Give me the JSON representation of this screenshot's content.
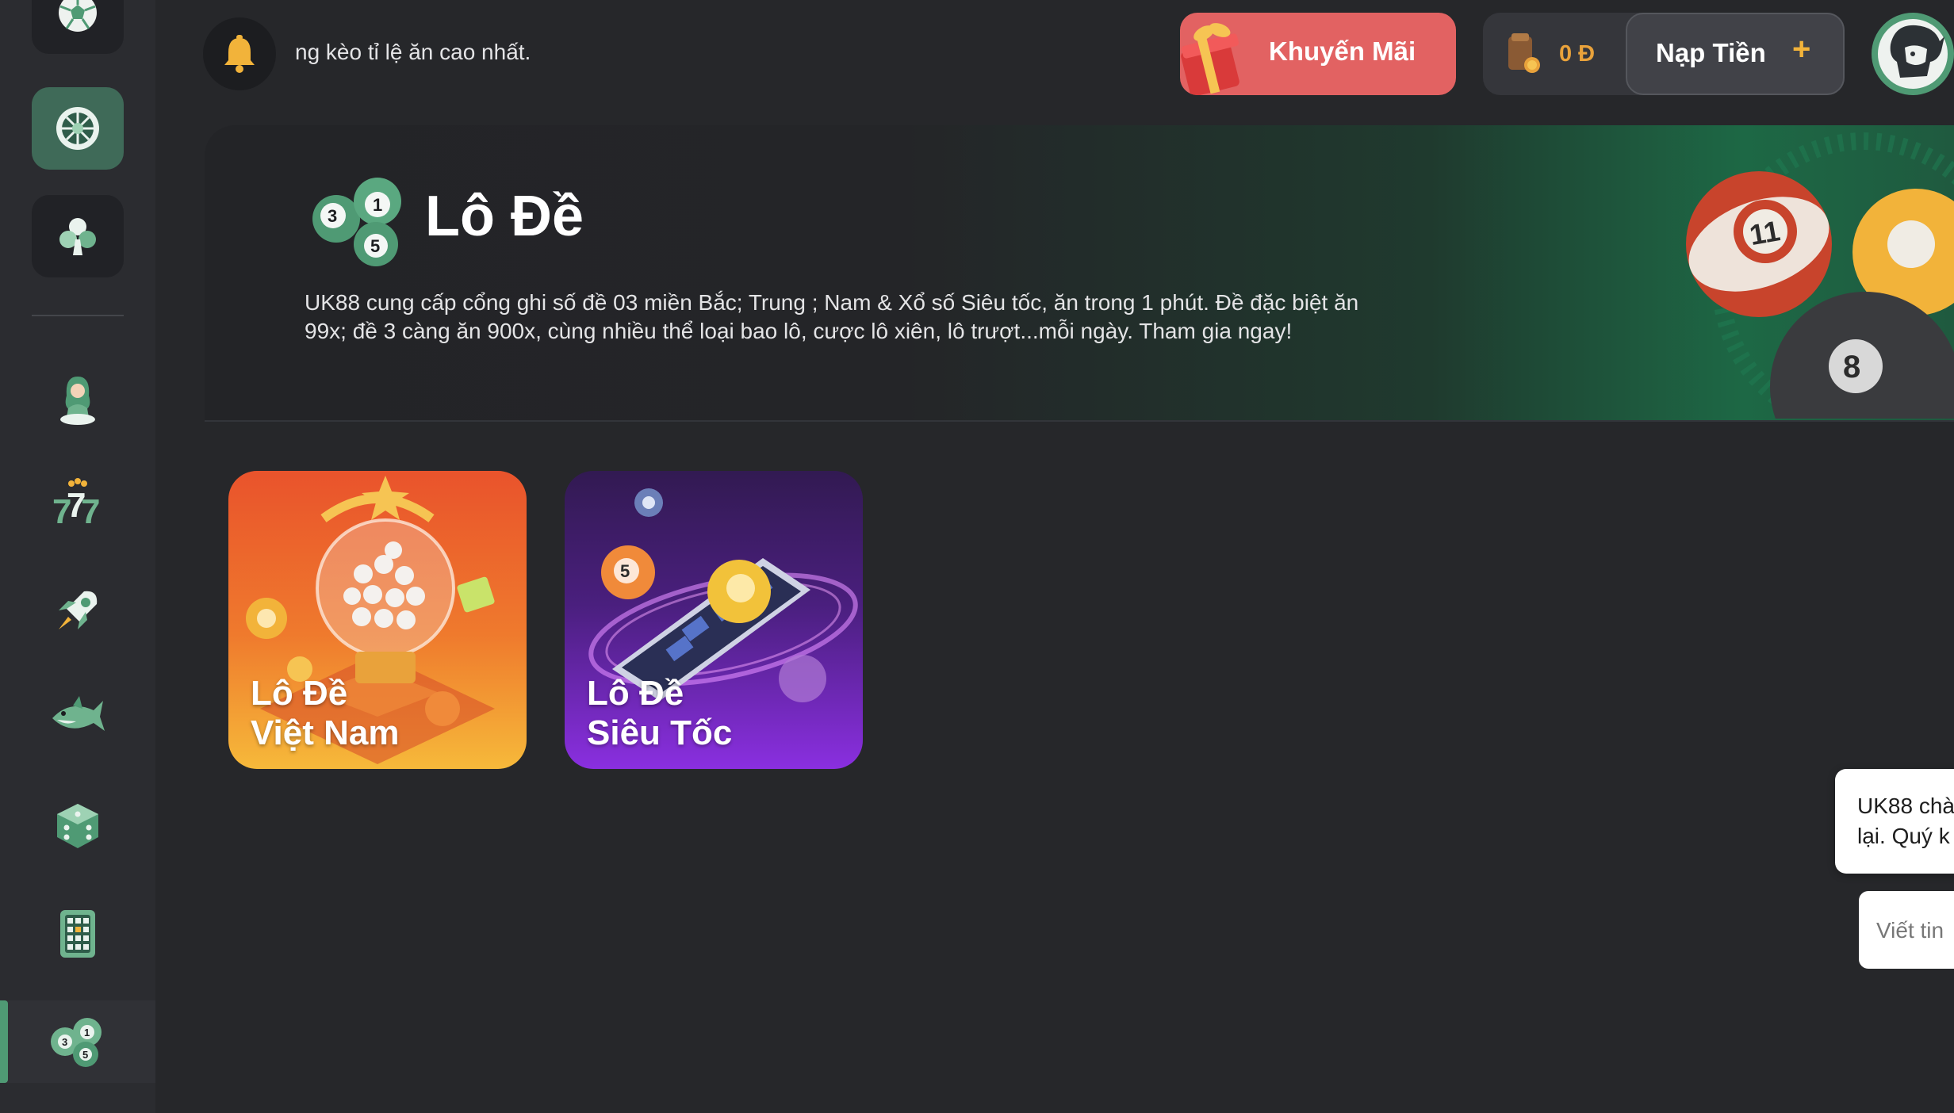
{
  "header": {
    "marquee_text": "ng kèo tỉ lệ ăn cao nhất.",
    "promo_label": "Khuyến Mãi",
    "balance": "0 Đ",
    "deposit_label": "Nạp Tiền",
    "deposit_plus": "+"
  },
  "sidebar": {
    "items": [
      {
        "icon": "soccer-ball-icon"
      },
      {
        "icon": "roulette-wheel-icon",
        "active": true
      },
      {
        "icon": "card-club-icon"
      },
      {
        "icon": "live-casino-dealer-icon"
      },
      {
        "icon": "slot-777-icon"
      },
      {
        "icon": "rocket-icon"
      },
      {
        "icon": "shark-fish-icon"
      },
      {
        "icon": "dice-icon"
      },
      {
        "icon": "keno-board-icon"
      },
      {
        "icon": "lottery-balls-icon",
        "selected": true
      }
    ]
  },
  "banner": {
    "title": "Lô Đề",
    "description": "UK88 cung cấp cổng ghi số đề 03 miền Bắc; Trung ; Nam & Xổ số Siêu tốc, ăn trong 1 phút. Đề đặc biệt ăn 99x; đề 3 càng ăn 900x, cùng nhiều thể loại bao lô, cược lô xiên, lô trượt...mỗi ngày. Tham gia ngay!"
  },
  "games": [
    {
      "line1": "Lô Đề",
      "line2": "Việt Nam"
    },
    {
      "line1": "Lô Đề",
      "line2": "Siêu Tốc"
    }
  ],
  "chat": {
    "message": "UK88 chà\nlại. Quý k",
    "input_placeholder": "Viết tin"
  },
  "colors": {
    "accent_green": "#4f9a74",
    "promo_red": "#e26262",
    "balance_gold": "#e9a23b",
    "background": "#26272a"
  }
}
